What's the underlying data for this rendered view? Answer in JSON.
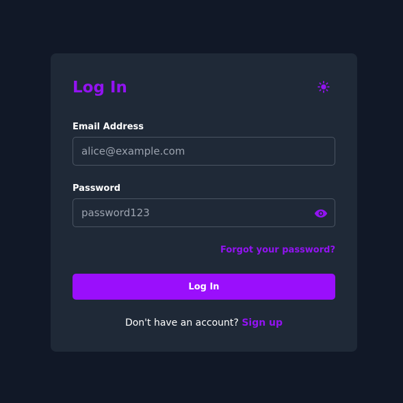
{
  "header": {
    "title": "Log In"
  },
  "icons": {
    "theme_toggle": "sun-icon",
    "password_visibility": "eye-icon"
  },
  "email": {
    "label": "Email Address",
    "placeholder": "alice@example.com",
    "value": ""
  },
  "password": {
    "label": "Password",
    "placeholder": "password123",
    "value": ""
  },
  "links": {
    "forgot": "Forgot your password?",
    "signup_prompt": "Don't have an account?",
    "signup": "Sign up"
  },
  "actions": {
    "submit_label": "Log In"
  },
  "colors": {
    "background": "#111827",
    "card": "#1f2937",
    "accent": "#9213f1",
    "button": "#9a0ffc",
    "input_border": "#4b5563",
    "placeholder": "#9ca3af"
  }
}
